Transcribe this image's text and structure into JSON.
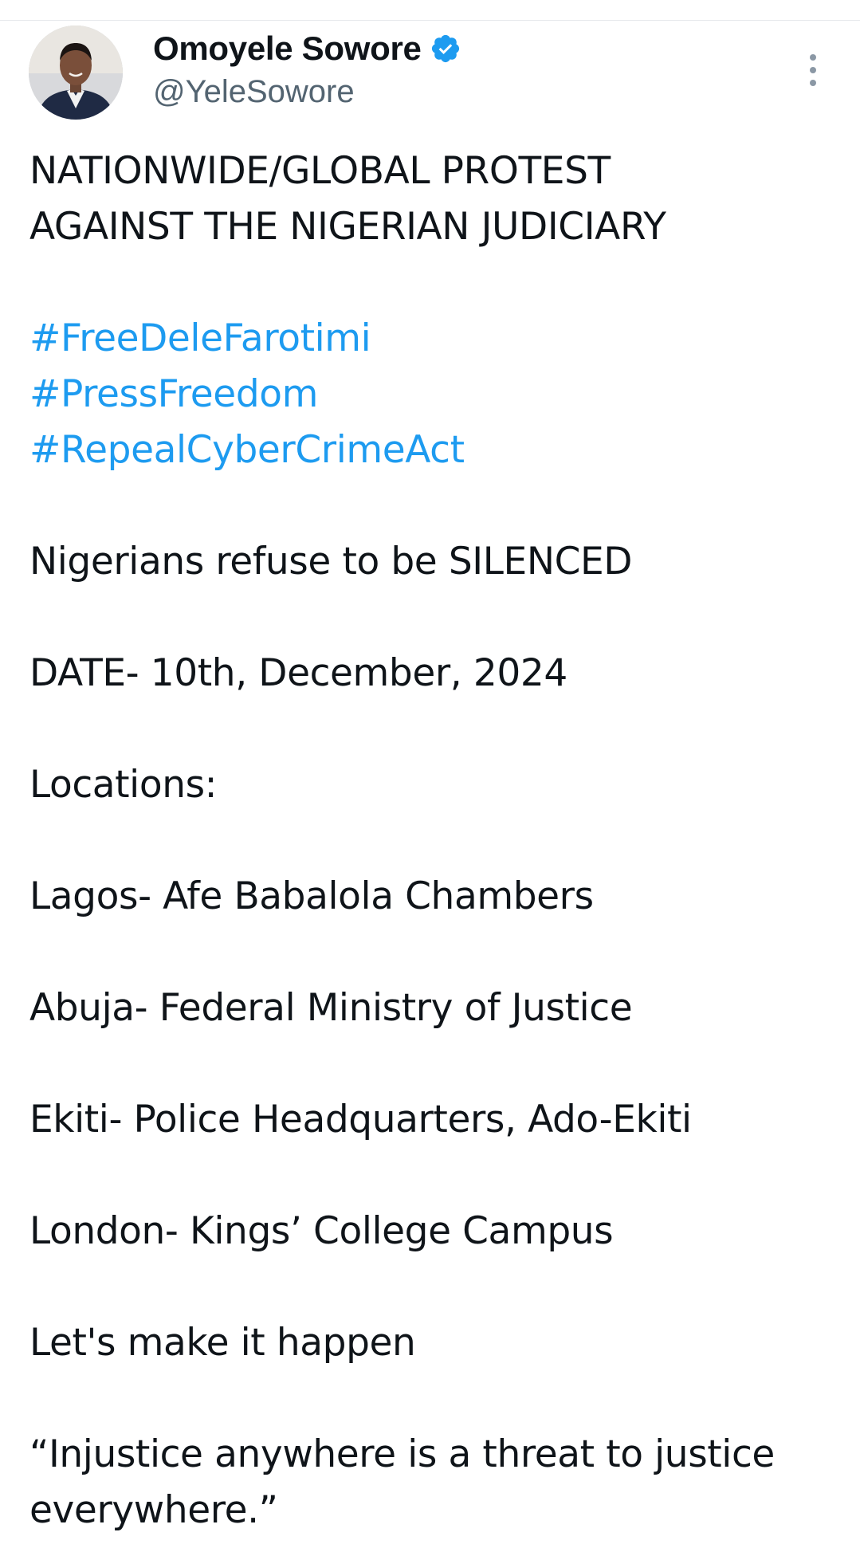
{
  "author": {
    "display_name": "Omoyele Sowore",
    "handle": "@YeleSowore",
    "verified": true,
    "verified_color": "#1d9bf0"
  },
  "tweet": {
    "title_line_1": "NATIONWIDE/GLOBAL PROTEST",
    "title_line_2": "AGAINST THE NIGERIAN JUDICIARY",
    "hashtags": [
      "#FreeDeleFarotimi",
      "#PressFreedom",
      "#RepealCyberCrimeAct"
    ],
    "slogan": "Nigerians refuse to be SILENCED",
    "date": "DATE- 10th, December, 2024",
    "locations_heading": "Locations:",
    "locations": [
      "Lagos- Afe Babalola Chambers",
      "Abuja- Federal Ministry of Justice",
      "Ekiti- Police Headquarters, Ado-Ekiti",
      "London- Kings’ College Campus"
    ],
    "call_to_action": "Let's make it happen",
    "quote": "“Injustice anywhere is a threat to justice everywhere.”"
  },
  "icons": {
    "avatar": "profile-photo",
    "verified": "verified-badge-icon",
    "more": "more-options-icon"
  },
  "colors": {
    "text": "#0f1419",
    "secondary_text": "#536471",
    "link": "#1d9bf0"
  }
}
